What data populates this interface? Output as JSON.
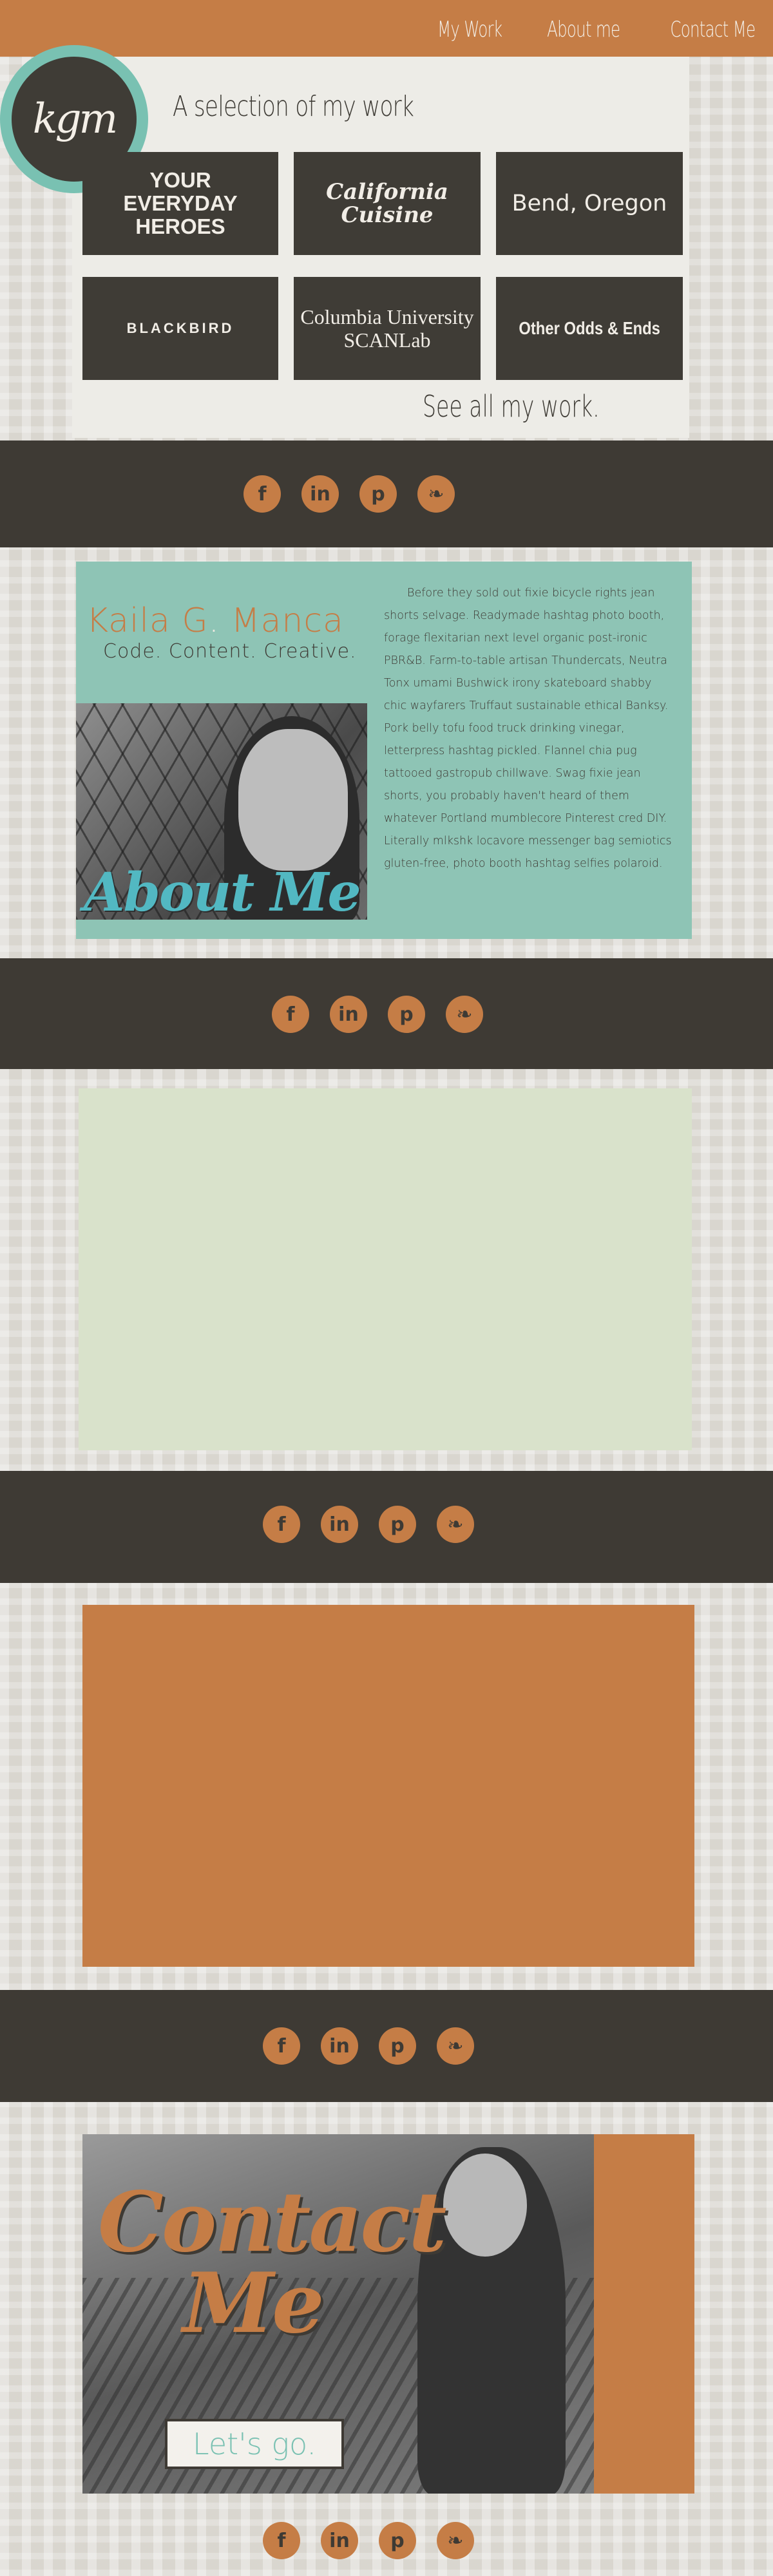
{
  "nav": {
    "items": [
      {
        "label": "My Work"
      },
      {
        "label": "About me"
      },
      {
        "label": "Contact Me"
      }
    ]
  },
  "logo": {
    "text": "kgm"
  },
  "work": {
    "title": "A selection of my work",
    "tiles": [
      {
        "label": "YOUR\nEVERYDAY\nHEROES"
      },
      {
        "label": "California\nCuisine"
      },
      {
        "label": "Bend, Oregon"
      },
      {
        "label": "BLACKBIRD"
      },
      {
        "label": "Columbia University\nSCANLab"
      },
      {
        "label": "Other Odds & Ends"
      }
    ],
    "see_all": "See all my work."
  },
  "social": {
    "facebook": "f",
    "linkedin": "in",
    "pinterest": "p",
    "twitter": "❧"
  },
  "about": {
    "name_first": "Kaila G",
    "name_dot": ".",
    "name_last": " Manca",
    "tagline": "Code. Content. Creative.",
    "script_title": "About Me",
    "body": "Before they sold out fixie bicycle rights jean shorts selvage. Readymade hashtag photo booth, forage flexitarian next level organic post-ironic PBR&B. Farm-to-table artisan Thundercats, Neutra Tonx umami Bushwick irony skateboard shabby chic wayfarers Truffaut sustainable ethical Banksy. Pork belly tofu food truck drinking vinegar, letterpress hashtag pickled. Flannel chia pug tattooed gastropub chillwave. Swag fixie jean shorts, you probably haven't heard of them whatever Portland mumblecore Pinterest cred DIY. Literally mlkshk locavore messenger bag semiotics gluten-free, photo booth hashtag selfies polaroid."
  },
  "contact": {
    "title": "Contact\nMe",
    "button": "Let's go."
  },
  "colors": {
    "orange": "#c57d46",
    "dark": "#3e3a34",
    "teal": "#8ec4b5",
    "mint": "#d9e2cb"
  }
}
